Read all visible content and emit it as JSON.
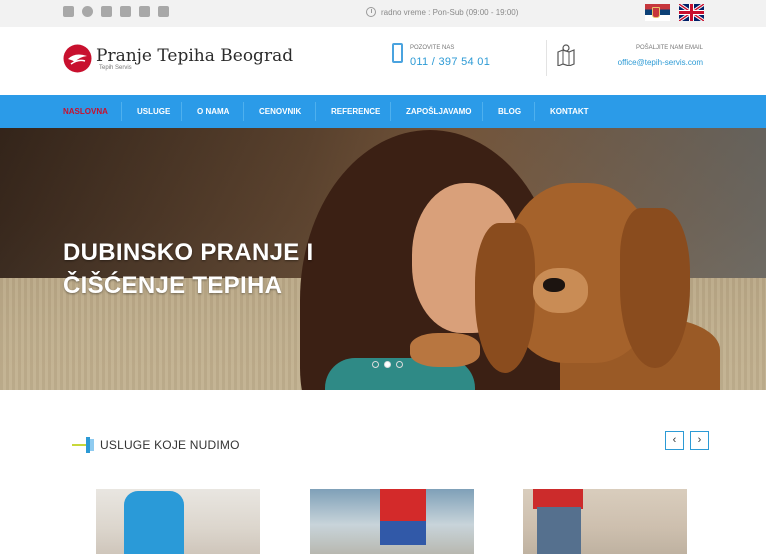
{
  "topbar": {
    "social_icons": [
      "envelope-icon",
      "skype-icon",
      "facebook-icon",
      "twitter-icon",
      "google-plus-icon",
      "youtube-icon"
    ],
    "hours": "radno vreme : Pon-Sub (09:00 - 19:00)",
    "languages": [
      "sr",
      "en"
    ]
  },
  "header": {
    "logo_title": "Pranje Tepiha Beograd",
    "logo_subtitle": "Tepih Servis",
    "phone_label": "POZOVITE NAS",
    "phone_number": "011 / 397 54 01",
    "email_label": "POŠALJITE NAM EMAIL",
    "email": "office@tepih-servis.com"
  },
  "nav": {
    "items": [
      {
        "label": "NASLOVNA",
        "active": true
      },
      {
        "label": "USLUGE"
      },
      {
        "label": "O NAMA"
      },
      {
        "label": "CENOVNIK"
      },
      {
        "label": "REFERENCE"
      },
      {
        "label": "ZAPOŠLJAVAMO"
      },
      {
        "label": "BLOG"
      },
      {
        "label": "KONTAKT"
      }
    ]
  },
  "hero": {
    "title_line1": "DUBINSKO PRANJE I",
    "title_line2": "ČIŠĆENJE TEPIHA",
    "slide_count": 3,
    "active_slide": 2
  },
  "services": {
    "title": "USLUGE KOJE NUDIMO",
    "prev_label": "‹",
    "next_label": "›"
  },
  "colors": {
    "nav_bg": "#2b9be8",
    "accent": "#2c9ad5",
    "active_nav": "#c8102e",
    "logo_red": "#c8102e"
  }
}
